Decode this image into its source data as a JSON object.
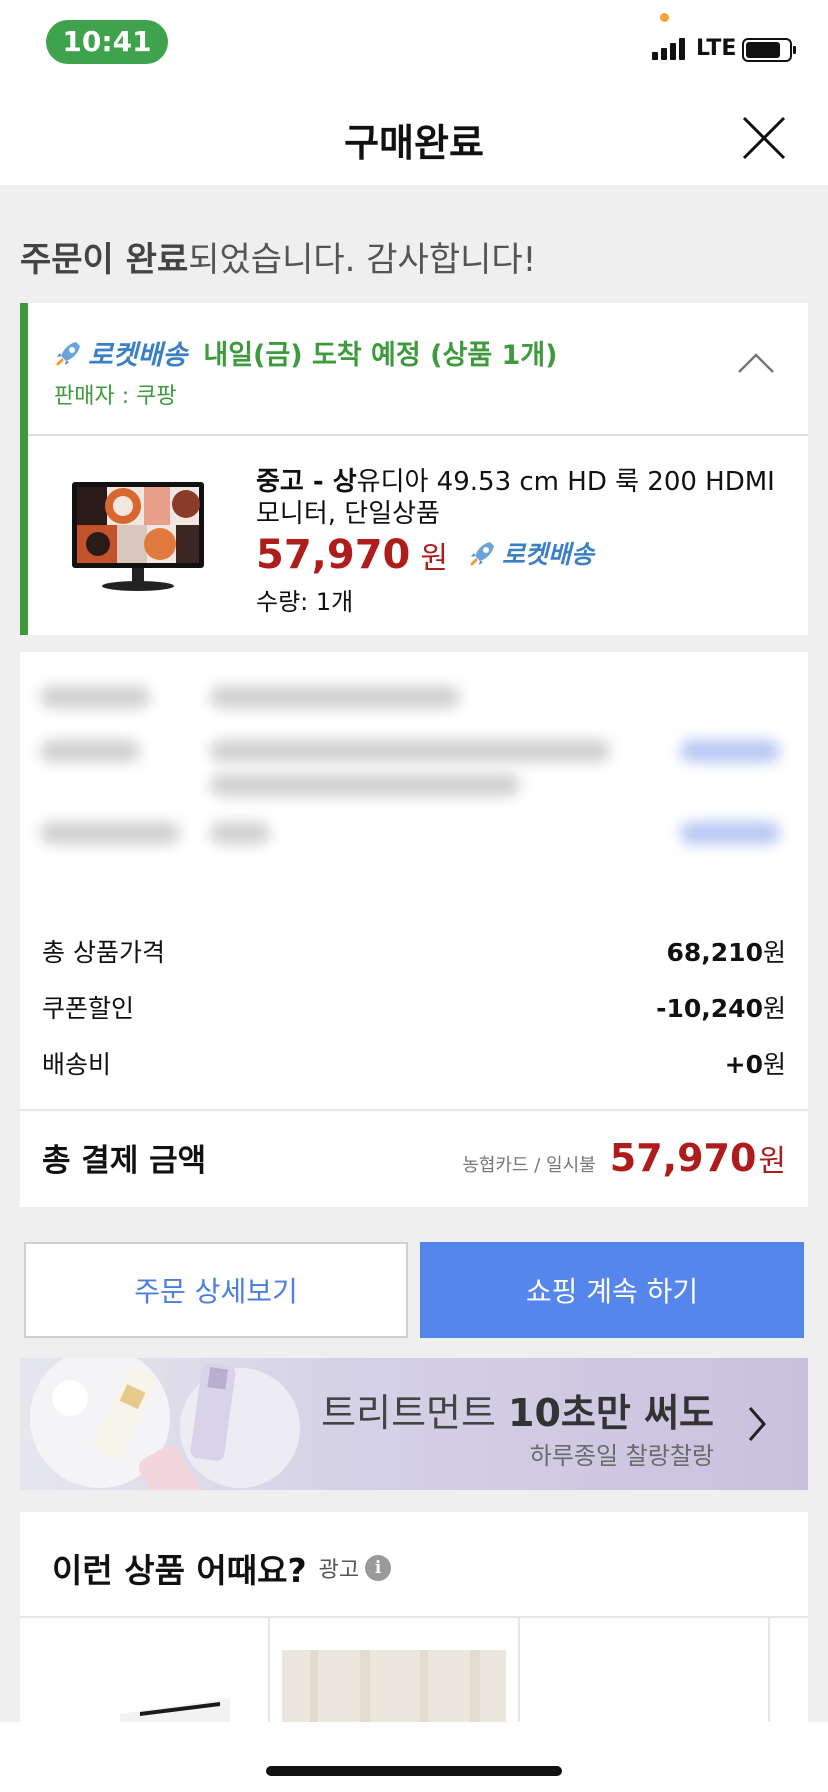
{
  "status_bar": {
    "time": "10:41",
    "network": "LTE"
  },
  "nav": {
    "title": "구매완료"
  },
  "message": {
    "bold": "주문이 완료",
    "rest": "되었습니다. 감사합니다!"
  },
  "delivery": {
    "brand": "로켓배송",
    "eta": "내일(금) 도착 예정 (상품 1개)",
    "seller": "판매자 : 쿠팡",
    "collapse_icon": "chevron-up-icon"
  },
  "product": {
    "condition": "중고 - 상",
    "name": "유디아 49.53 cm HD 룩 200 HDMI 모니터, 단일상품",
    "price": "57,970",
    "currency": "원",
    "badge": "로켓배송",
    "quantity": "수량: 1개"
  },
  "summary": {
    "rows": [
      {
        "label": "총 상품가격",
        "value": "68,210",
        "unit": "원"
      },
      {
        "label": "쿠폰할인",
        "value": "-10,240",
        "unit": "원"
      },
      {
        "label": "배송비",
        "value": "+0",
        "unit": "원"
      }
    ],
    "total_label": "총 결제 금액",
    "payment_method": "농협카드 / 일시불",
    "total_amount": "57,970",
    "total_unit": "원"
  },
  "buttons": {
    "detail": "주문 상세보기",
    "continue": "쇼핑 계속 하기"
  },
  "banner": {
    "main_prefix": "트리트먼트 ",
    "main_bold": "10초만 써도",
    "sub": "하루종일 찰랑찰랑"
  },
  "recommendation": {
    "title": "이런 상품 어때요?",
    "ad_label": "광고",
    "info_glyph": "i"
  },
  "colors": {
    "accent_green": "#3d9a3d",
    "price_red": "#ae1c1c",
    "primary_blue": "#5586ec",
    "rocket_blue": "#3b7fc4"
  }
}
